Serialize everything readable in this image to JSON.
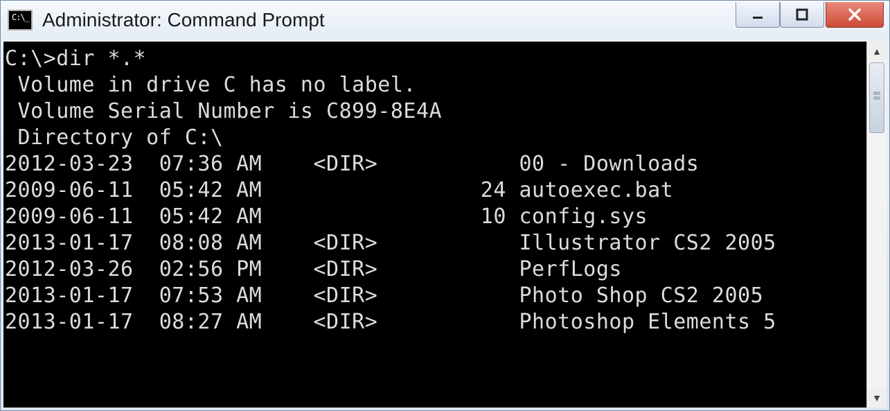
{
  "window": {
    "title": "Administrator: Command Prompt"
  },
  "terminal": {
    "prompt_line": "C:\\>dir *.*",
    "volume_label": " Volume in drive C has no label.",
    "volume_serial": " Volume Serial Number is C899-8E4A",
    "blank": "",
    "directory_of": " Directory of C:\\",
    "blank2": "",
    "entries": [
      {
        "date": "2012-03-23",
        "time": "07:36 AM",
        "dir": "<DIR>",
        "size": "",
        "name": "00 - Downloads"
      },
      {
        "date": "2009-06-11",
        "time": "05:42 AM",
        "dir": "",
        "size": "24",
        "name": "autoexec.bat"
      },
      {
        "date": "2009-06-11",
        "time": "05:42 AM",
        "dir": "",
        "size": "10",
        "name": "config.sys"
      },
      {
        "date": "2013-01-17",
        "time": "08:08 AM",
        "dir": "<DIR>",
        "size": "",
        "name": "Illustrator CS2 2005"
      },
      {
        "date": "2012-03-26",
        "time": "02:56 PM",
        "dir": "<DIR>",
        "size": "",
        "name": "PerfLogs"
      },
      {
        "date": "2013-01-17",
        "time": "07:53 AM",
        "dir": "<DIR>",
        "size": "",
        "name": "Photo Shop CS2 2005"
      },
      {
        "date": "2013-01-17",
        "time": "08:27 AM",
        "dir": "<DIR>",
        "size": "",
        "name": "Photoshop Elements 5"
      }
    ]
  }
}
